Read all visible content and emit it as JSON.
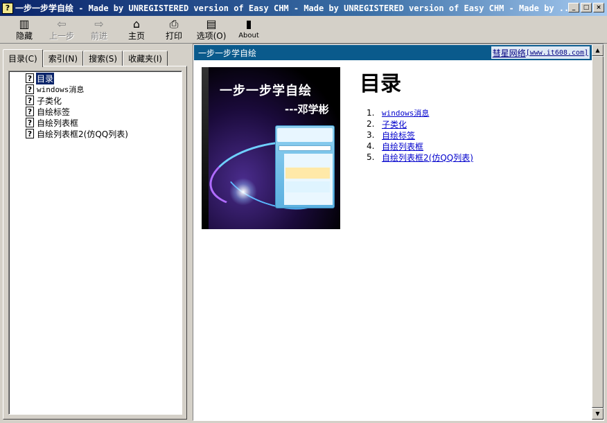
{
  "window": {
    "title": "一步一步学自绘 - Made by UNREGISTERED version of Easy CHM - Made by UNREGISTERED version of Easy CHM - Made by ...",
    "minimize": "_",
    "maximize": "□",
    "close": "×"
  },
  "toolbar": {
    "hide": "隐藏",
    "back": "上一步",
    "forward": "前进",
    "home": "主页",
    "print": "打印",
    "options": "选项(O)",
    "about": "About"
  },
  "tabs": {
    "contents": "目录(C)",
    "index": "索引(N)",
    "search": "搜索(S)",
    "favorites": "收藏夹(I)"
  },
  "tree": [
    {
      "label": "目录",
      "selected": true
    },
    {
      "label": "windows消息"
    },
    {
      "label": "子类化"
    },
    {
      "label": "自绘标签"
    },
    {
      "label": "自绘列表框"
    },
    {
      "label": "自绘列表框2(仿QQ列表)"
    }
  ],
  "content": {
    "banner_title": "一步一步学自绘",
    "banner_site": "彗星网络",
    "banner_url": "[www.it608.com]",
    "cover_title": "一步一步学自绘",
    "cover_author": "---邓学彬",
    "heading": "目录",
    "toc": [
      {
        "num": "1.",
        "label": "windows消息"
      },
      {
        "num": "2.",
        "label": "子类化"
      },
      {
        "num": "3.",
        "label": "自绘标签"
      },
      {
        "num": "4.",
        "label": "自绘列表框"
      },
      {
        "num": "5.",
        "label": "自绘列表框2(仿QQ列表)"
      }
    ]
  },
  "icons": {
    "app": "question-book-icon",
    "topic": "question-page-icon"
  }
}
